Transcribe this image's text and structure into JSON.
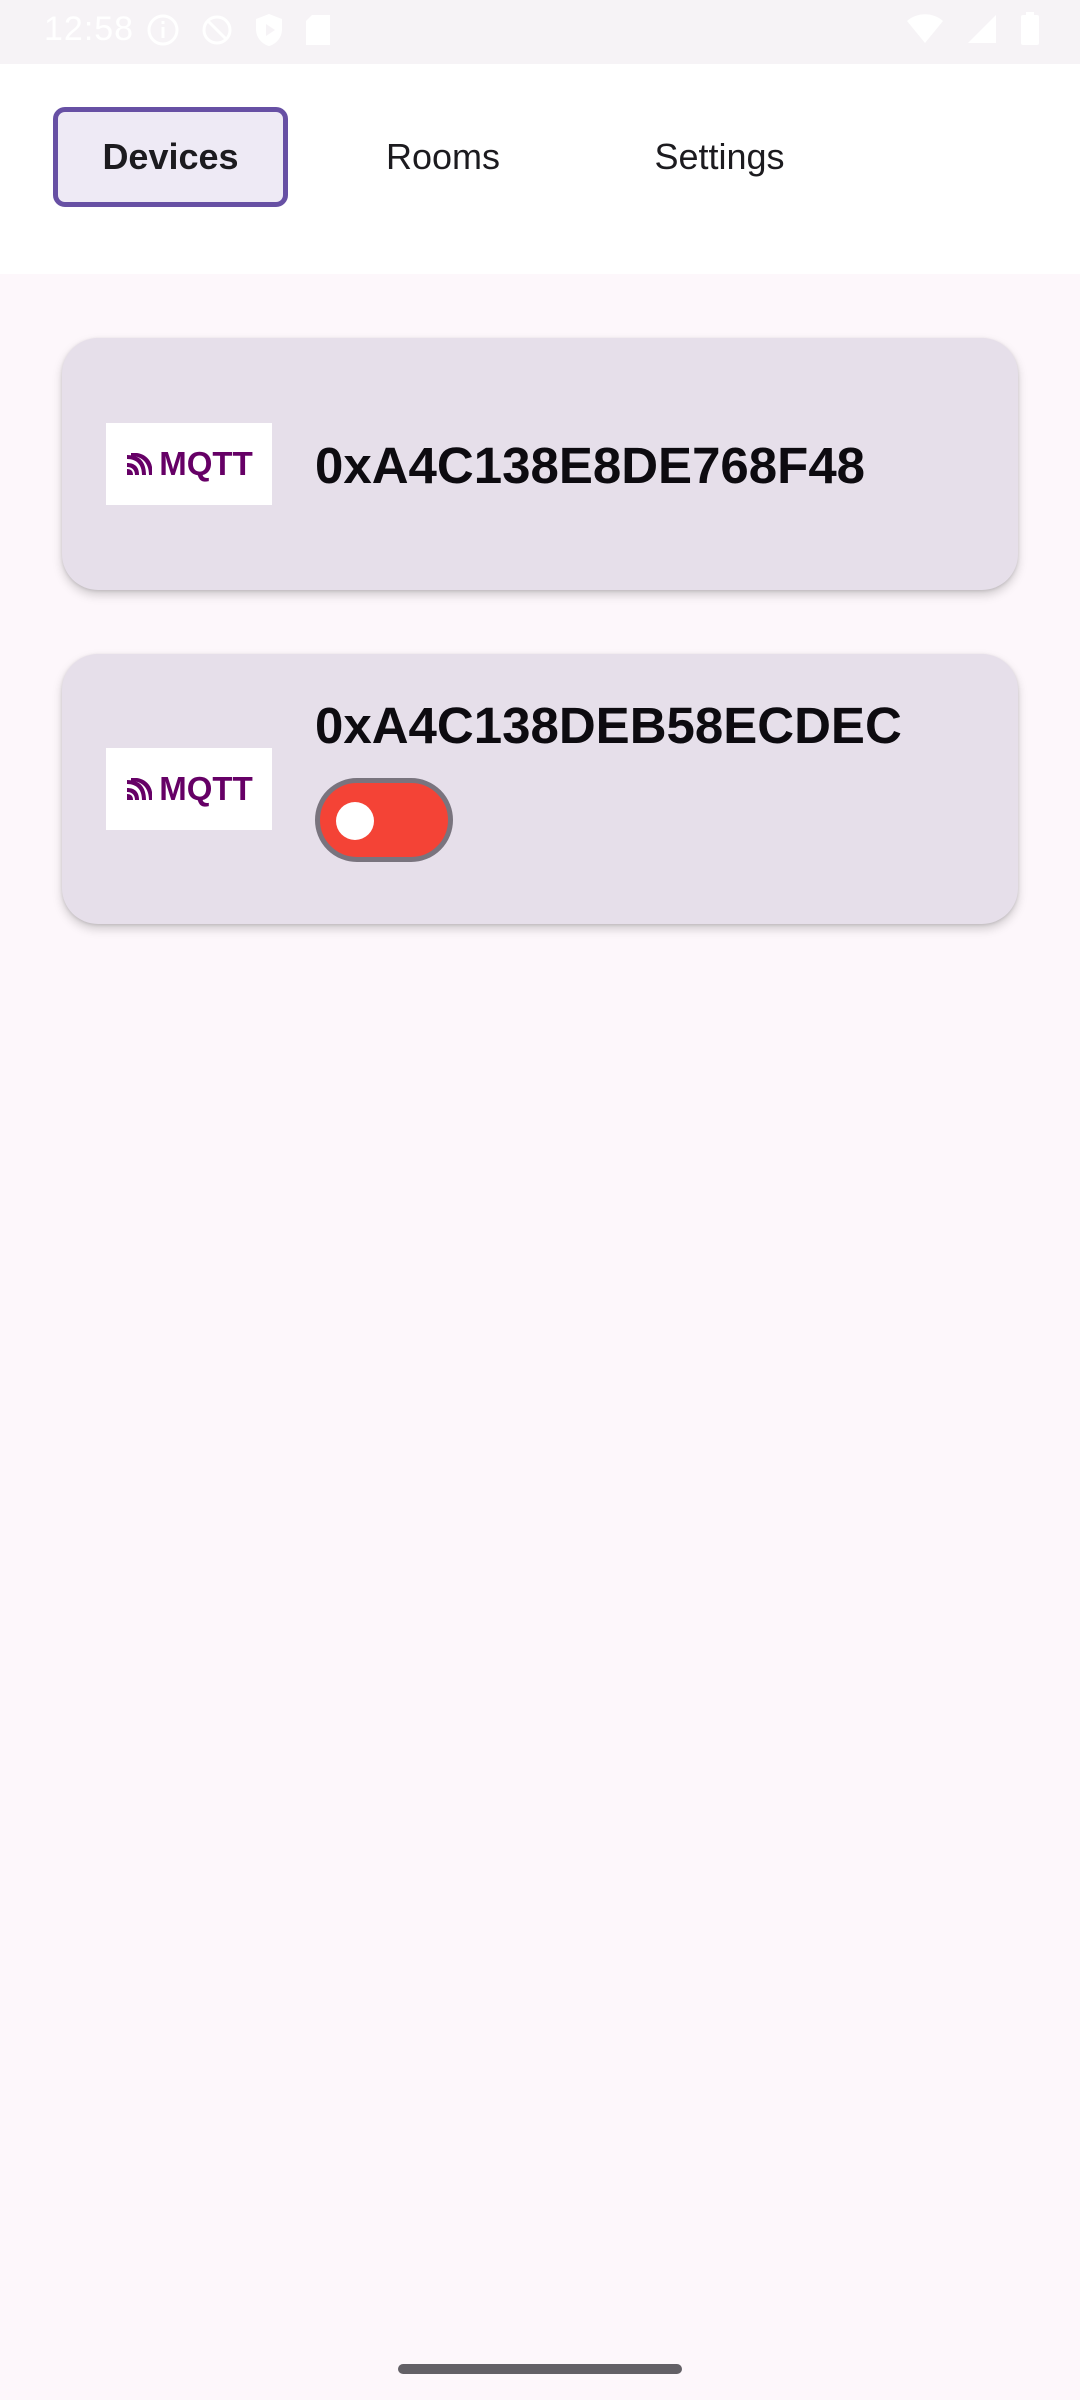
{
  "status_bar": {
    "time": "12:58",
    "icons_left": [
      "info-icon",
      "no-disturb-icon",
      "shield-icon",
      "sd-card-icon"
    ],
    "icons_right": [
      "wifi-icon",
      "signal-icon",
      "battery-icon"
    ]
  },
  "tabs": [
    {
      "label": "Devices",
      "selected": true
    },
    {
      "label": "Rooms",
      "selected": false
    },
    {
      "label": "Settings",
      "selected": false
    }
  ],
  "devices": [
    {
      "logo_text": "MQTT",
      "logo_icon": "mqtt-logo-icon",
      "name": "0xA4C138E8DE768F48",
      "has_toggle": false
    },
    {
      "logo_text": "MQTT",
      "logo_icon": "mqtt-logo-icon",
      "name": "0xA4C138DEB58ECDEC",
      "has_toggle": true,
      "toggle_on": false,
      "toggle_color": "#f44336"
    }
  ],
  "colors": {
    "accent": "#6750a4",
    "background": "#fdf7fb",
    "card": "#e6dfea",
    "mqtt_brand": "#660066"
  }
}
